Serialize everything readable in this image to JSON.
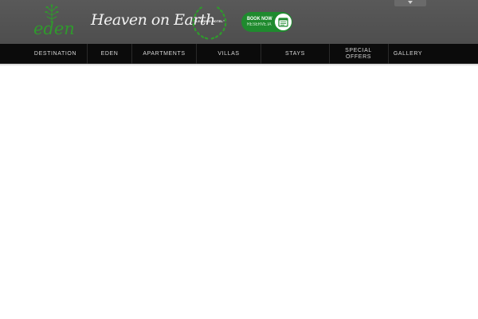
{
  "header": {
    "logo_text": "eden",
    "tagline": "Heaven on Earth",
    "badge_text": "\"LEADING HOTEL\"",
    "book_button": {
      "line1": "BOOK NOW",
      "line2": "RESERVE.IA"
    }
  },
  "nav": {
    "items": [
      {
        "label": "DESTINATION"
      },
      {
        "label": "EDEN"
      },
      {
        "label": "APARTMENTS"
      },
      {
        "label": "VILLAS"
      },
      {
        "label": "STAYS"
      },
      {
        "label": "SPECIAL OFFERS"
      },
      {
        "label": "GALLERY"
      }
    ]
  },
  "colors": {
    "header_bg": "#555555",
    "nav_bg": "#0b0b0b",
    "brand_green": "#2f9a2c",
    "button_green": "#1f8a2e"
  },
  "icons": {
    "logo": "tree-icon",
    "badge": "laurel-wreath-icon",
    "book": "calendar-icon",
    "lang": "chevron-down-icon"
  }
}
